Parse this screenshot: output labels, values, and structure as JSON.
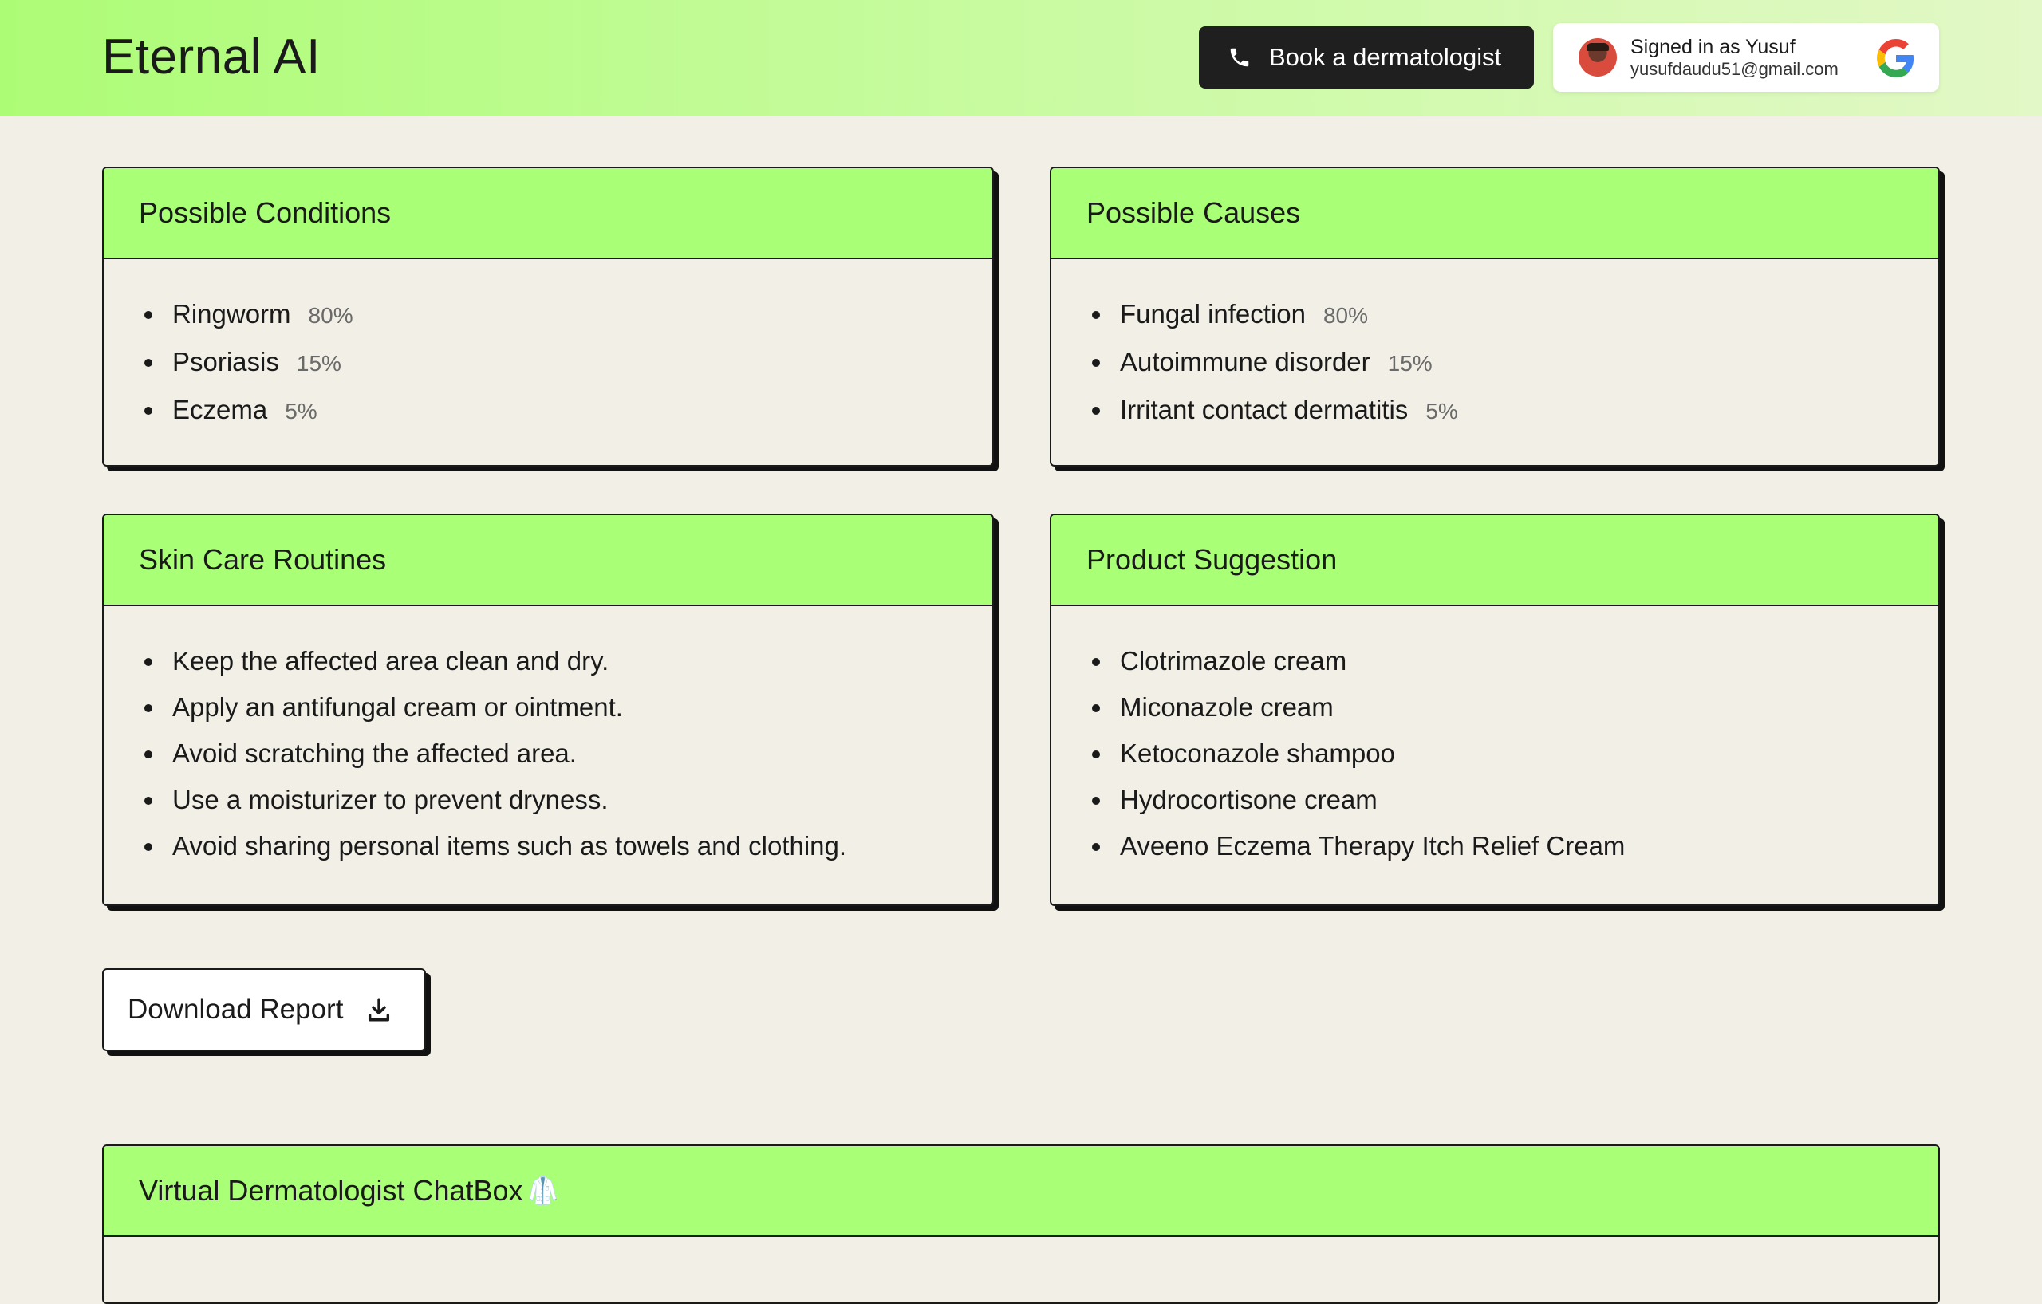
{
  "header": {
    "brand": "Eternal AI",
    "book_button": "Book a dermatologist",
    "account": {
      "signed_in_label": "Signed in as Yusuf",
      "email": "yusufdaudu51@gmail.com"
    }
  },
  "conditions": {
    "title": "Possible Conditions",
    "items": [
      {
        "name": "Ringworm",
        "pct": "80%"
      },
      {
        "name": "Psoriasis",
        "pct": "15%"
      },
      {
        "name": "Eczema",
        "pct": "5%"
      }
    ]
  },
  "causes": {
    "title": "Possible Causes",
    "items": [
      {
        "name": "Fungal infection",
        "pct": "80%"
      },
      {
        "name": "Autoimmune disorder",
        "pct": "15%"
      },
      {
        "name": "Irritant contact dermatitis",
        "pct": "5%"
      }
    ]
  },
  "routines": {
    "title": "Skin Care Routines",
    "items": [
      "Keep the affected area clean and dry.",
      "Apply an antifungal cream or ointment.",
      "Avoid scratching the affected area.",
      "Use a moisturizer to prevent dryness.",
      "Avoid sharing personal items such as towels and clothing."
    ]
  },
  "products": {
    "title": "Product Suggestion",
    "items": [
      "Clotrimazole cream",
      "Miconazole cream",
      "Ketoconazole shampoo",
      "Hydrocortisone cream",
      "Aveeno Eczema Therapy Itch Relief Cream"
    ]
  },
  "download_button": "Download Report",
  "chat": {
    "title": "Virtual Dermatologist ChatBox",
    "emoji": "🥼"
  },
  "colors": {
    "accent": "#a9ff75",
    "background": "#f2f0e6",
    "dark": "#1f1f1f"
  }
}
